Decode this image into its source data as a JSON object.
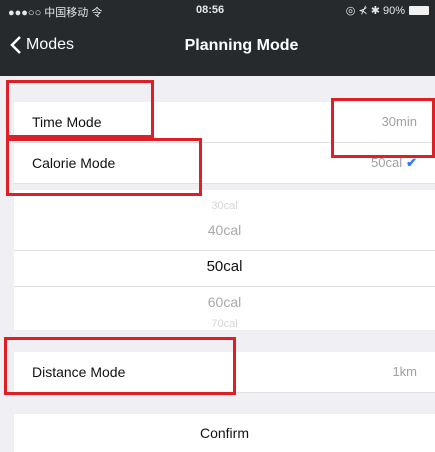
{
  "status_bar": {
    "carrier": "●●●○○ 中国移动 令",
    "time": "08:56",
    "right": "◎ ⊀ ✱ 90%"
  },
  "nav": {
    "back_label": "Modes",
    "title": "Planning Mode"
  },
  "rows": {
    "time_mode": {
      "label": "Time Mode",
      "value": "30min"
    },
    "calorie_mode": {
      "label": "Calorie Mode",
      "value": "50cal"
    },
    "distance_mode": {
      "label": "Distance Mode",
      "value": "1km"
    }
  },
  "picker": {
    "options": [
      "30cal",
      "40cal",
      "50cal",
      "60cal",
      "70cal"
    ],
    "selected": "50cal"
  },
  "confirm_label": "Confirm",
  "colors": {
    "highlight": "#e01e26",
    "navbar": "#262a2d",
    "check": "#2f7cf6"
  }
}
